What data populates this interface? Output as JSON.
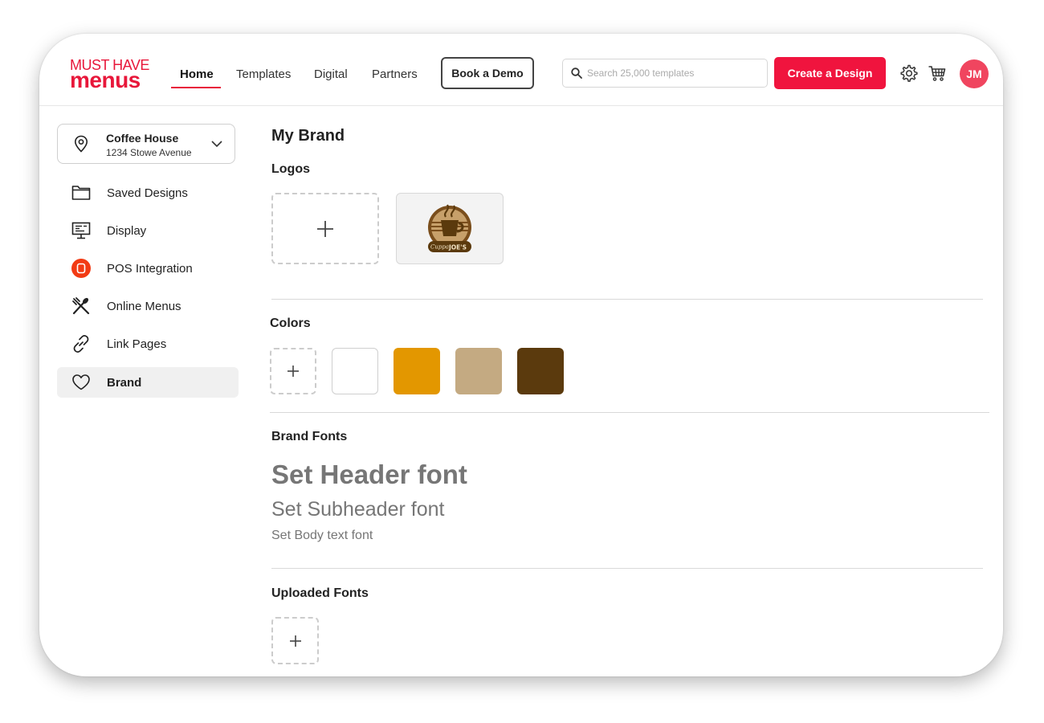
{
  "brand": {
    "logo_line1": "MUST HAVE",
    "logo_line2": "menus",
    "color": "#e8173a"
  },
  "nav": {
    "home": "Home",
    "templates": "Templates",
    "digital": "Digital",
    "partners": "Partners",
    "book_demo": "Book a Demo"
  },
  "search": {
    "placeholder": "Search 25,000 templates"
  },
  "header": {
    "create_label": "Create a Design",
    "avatar_initials": "JM"
  },
  "location": {
    "name": "Coffee House",
    "address": "1234 Stowe Avenue"
  },
  "sidebar": {
    "items": [
      {
        "label": "Saved Designs",
        "icon": "folder-icon"
      },
      {
        "label": "Display",
        "icon": "monitor-icon"
      },
      {
        "label": "POS Integration",
        "icon": "pos-icon"
      },
      {
        "label": "Online Menus",
        "icon": "utensils-icon"
      },
      {
        "label": "Link Pages",
        "icon": "link-icon"
      },
      {
        "label": "Brand",
        "icon": "heart-icon",
        "active": true
      }
    ]
  },
  "main": {
    "title": "My Brand",
    "logos_heading": "Logos",
    "logo_tile_text": {
      "left": "Cuppa",
      "right": "JOE'S"
    },
    "colors_heading": "Colors",
    "swatches": [
      "#ffffff",
      "#e39700",
      "#c4aa82",
      "#5b3a0d"
    ],
    "fonts_heading": "Brand Fonts",
    "header_font": "Set Header font",
    "subheader_font": "Set Subheader font",
    "body_font": "Set Body text font",
    "uploaded_heading": "Uploaded Fonts"
  }
}
